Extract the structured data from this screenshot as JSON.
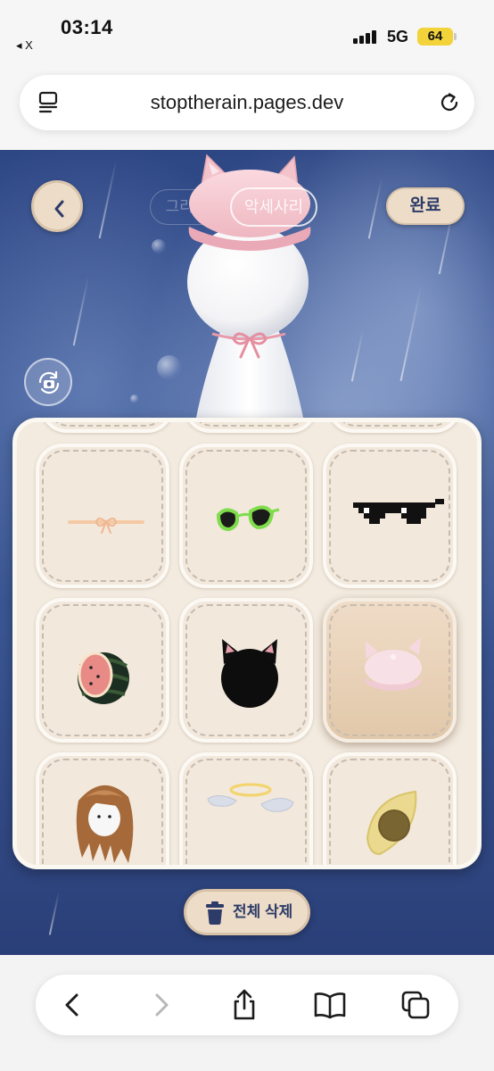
{
  "status_bar": {
    "time": "03:14",
    "back_app": "◂ X",
    "network": "5G",
    "battery": "64"
  },
  "address_bar": {
    "url": "stoptherain.pages.dev"
  },
  "app": {
    "tabs": [
      {
        "label": "그리기",
        "active": false
      },
      {
        "label": "악세사리",
        "active": true
      }
    ],
    "done_label": "완료",
    "delete_all_label": "전체 삭제",
    "items": [
      {
        "name": "ribbon-necklace",
        "selected": false
      },
      {
        "name": "green-sunglasses",
        "selected": false
      },
      {
        "name": "pixel-sunglasses",
        "selected": false
      },
      {
        "name": "watermelon",
        "selected": false
      },
      {
        "name": "black-cat-hood",
        "selected": false
      },
      {
        "name": "pink-cat-beret",
        "selected": true
      },
      {
        "name": "brown-wig",
        "selected": false
      },
      {
        "name": "angel-halo-wings",
        "selected": false
      },
      {
        "name": "seed-leaf",
        "selected": false
      }
    ],
    "colors": {
      "panel": "#f3ebe0",
      "button_bg": "#ecdcc8",
      "button_text": "#2d3b68",
      "sky": "#3a5592"
    }
  }
}
